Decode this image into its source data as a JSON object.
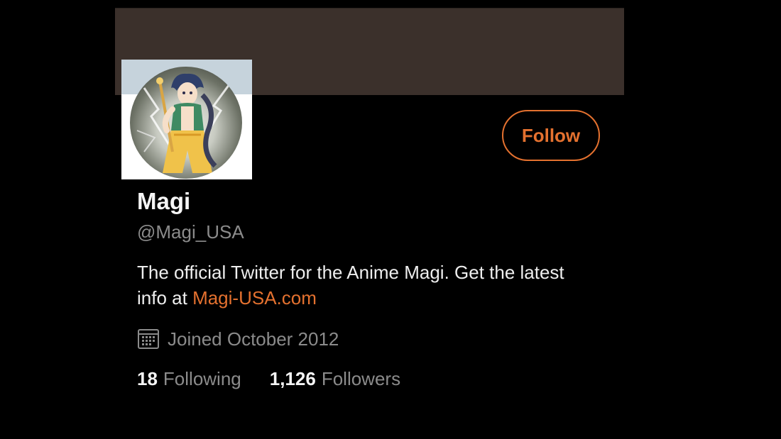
{
  "colors": {
    "accent": "#e4712f",
    "background": "#000000",
    "banner": "#3b302b",
    "primary_text": "#f5f5f5",
    "secondary_text": "#8b8b8b"
  },
  "profile": {
    "display_name": "Magi",
    "handle": "@Magi_USA",
    "bio_text": "The official Twitter for the Anime Magi.  Get the latest info at ",
    "bio_link": "Magi-USA.com",
    "joined": "Joined October 2012",
    "joined_icon": "calendar-icon",
    "avatar_description": "anime character avatar"
  },
  "actions": {
    "follow_label": "Follow"
  },
  "stats": {
    "following_count": "18",
    "following_label": "Following",
    "followers_count": "1,126",
    "followers_label": "Followers"
  }
}
